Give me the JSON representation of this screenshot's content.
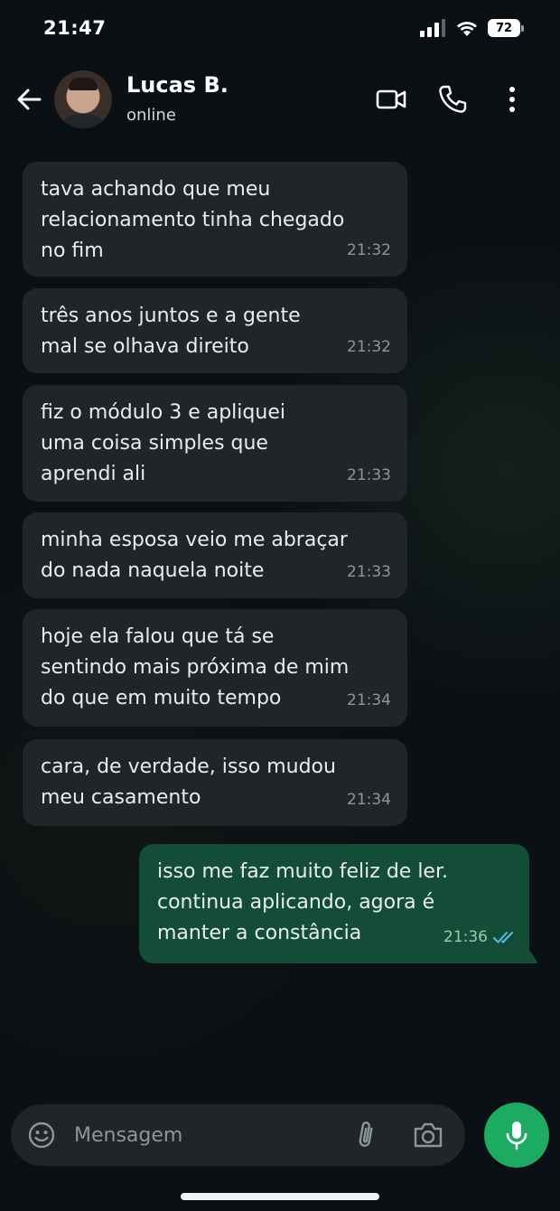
{
  "status_bar": {
    "time": "21:47",
    "battery": "72"
  },
  "header": {
    "name": "Lucas B.",
    "status": "online"
  },
  "messages": [
    {
      "direction": "incoming",
      "text": "tava achando que meu\nrelacionamento tinha chegado\nno fim",
      "time": "21:32"
    },
    {
      "direction": "incoming",
      "text": "três anos juntos e a gente\nmal se olhava direito",
      "time": "21:32"
    },
    {
      "direction": "incoming",
      "text": "fiz o módulo 3 e apliquei\numa coisa simples que\naprendi ali",
      "time": "21:33"
    },
    {
      "direction": "incoming",
      "text": "minha esposa veio me abraçar\ndo nada naquela noite",
      "time": "21:33"
    },
    {
      "direction": "incoming",
      "text": "hoje ela falou que tá se\nsentindo mais próxima de mim\ndo que em muito tempo",
      "time": "21:34"
    },
    {
      "direction": "incoming",
      "text": "cara, de verdade, isso mudou\nmeu casamento",
      "time": "21:34"
    },
    {
      "direction": "outgoing",
      "text": "isso me faz muito feliz de ler.\ncontinua aplicando, agora é\nmanter a constância",
      "time": "21:36",
      "read": true
    }
  ],
  "input": {
    "placeholder": "Mensagem",
    "value": ""
  },
  "colors": {
    "background": "#0b1014",
    "incoming_bubble": "#1f2528",
    "outgoing_bubble": "#134d37",
    "accent_green": "#1daa61",
    "read_ticks": "#53bdeb"
  },
  "icons": {
    "back": "arrow-left-icon",
    "video": "video-camera-icon",
    "call": "phone-icon",
    "menu": "more-vertical-icon",
    "emoji": "emoji-icon",
    "attach": "paperclip-icon",
    "camera": "camera-icon",
    "mic": "microphone-icon"
  }
}
